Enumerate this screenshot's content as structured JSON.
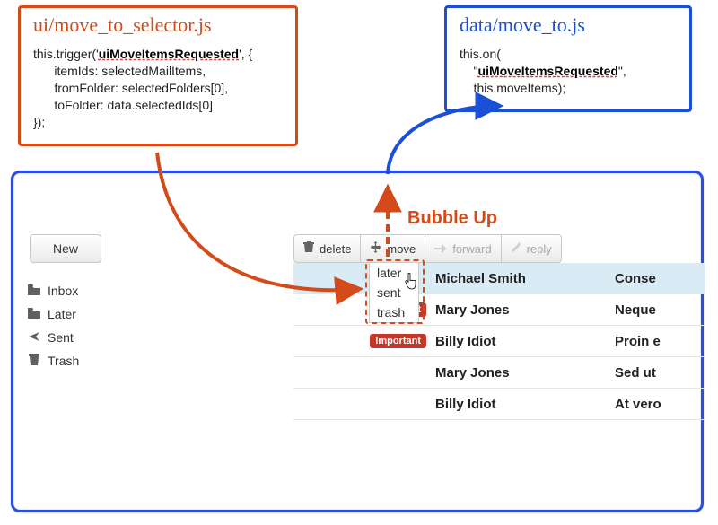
{
  "colors": {
    "orange": "#d34b1a",
    "blue": "#1b4fd6",
    "blueFrame": "#2a4fe0",
    "badge": "#c0392b"
  },
  "codeLeft": {
    "title": "ui/move_to_selector.js",
    "l1a": "this.trigger('",
    "l1b": "uiMoveItemsRequested",
    "l1c": "', {",
    "l2": "      itemIds: selectedMailItems,",
    "l3": "      fromFolder: selectedFolders[0],",
    "l4": "      toFolder: data.selectedIds[0]",
    "l5": "});"
  },
  "codeRight": {
    "title": "data/move_to.js",
    "l1": "this.on(",
    "l2a": "    \"",
    "l2b": "uiMoveItemsRequested",
    "l2c": "\",",
    "l3": "    this.moveItems);"
  },
  "bubbleLabel": "Bubble Up",
  "sidebar": {
    "newBtn": "New",
    "items": [
      {
        "icon": "folder",
        "label": "Inbox"
      },
      {
        "icon": "folder",
        "label": "Later"
      },
      {
        "icon": "sent",
        "label": "Sent"
      },
      {
        "icon": "trash",
        "label": "Trash"
      }
    ]
  },
  "toolbar": {
    "delete": "delete",
    "move": "move",
    "forward": "forward",
    "reply": "reply"
  },
  "dropdown": {
    "options": [
      {
        "label": "later"
      },
      {
        "label": "sent"
      },
      {
        "label": "trash"
      }
    ]
  },
  "mail": {
    "rows": [
      {
        "selected": true,
        "tag": "",
        "from": "Michael Smith",
        "subject": "Conse"
      },
      {
        "selected": false,
        "tag": "Important",
        "from": "Mary Jones",
        "subject": "Neque"
      },
      {
        "selected": false,
        "tag": "Important",
        "from": "Billy Idiot",
        "subject": "Proin e"
      },
      {
        "selected": false,
        "tag": "",
        "from": "Mary Jones",
        "subject": "Sed ut "
      },
      {
        "selected": false,
        "tag": "",
        "from": "Billy Idiot",
        "subject": "At vero"
      }
    ]
  }
}
